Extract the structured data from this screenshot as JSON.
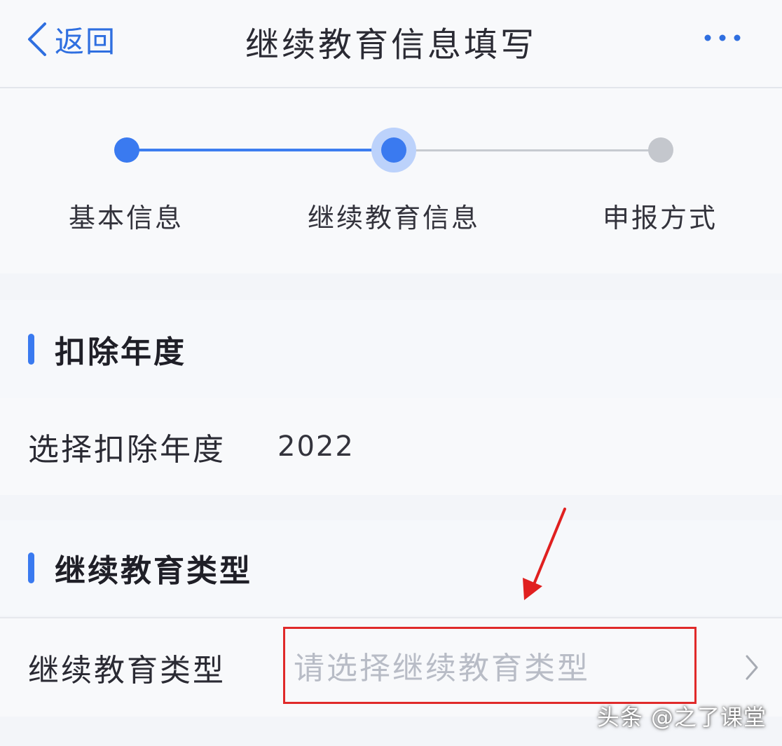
{
  "navbar": {
    "back_label": "返回",
    "title": "继续教育信息填写",
    "more_icon": "more-icon"
  },
  "stepper": {
    "steps": [
      {
        "label": "基本信息",
        "state": "done"
      },
      {
        "label": "继续教育信息",
        "state": "current"
      },
      {
        "label": "申报方式",
        "state": "todo"
      }
    ]
  },
  "section_year": {
    "title": "扣除年度",
    "row_label": "选择扣除年度",
    "row_value": "2022"
  },
  "section_type": {
    "title": "继续教育类型",
    "row_label": "继续教育类型",
    "placeholder": "请选择继续教育类型"
  },
  "watermark": "头条 @之了课堂",
  "colors": {
    "accent": "#3a7af0",
    "inactive": "#c4c7cd",
    "highlight_box": "#e02a2a",
    "placeholder_text": "#b8bcc6"
  }
}
